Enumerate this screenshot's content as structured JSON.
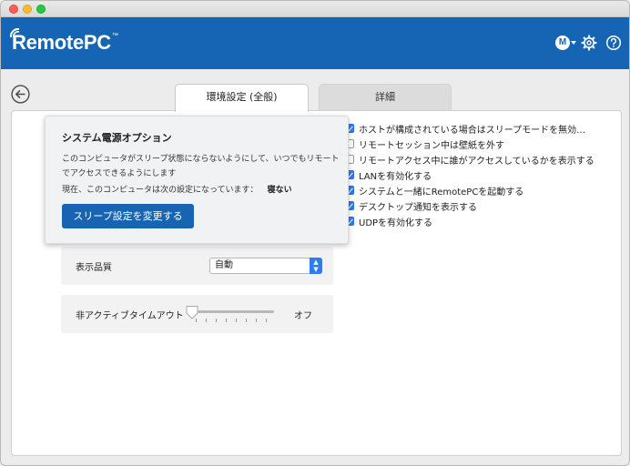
{
  "header": {
    "logo": "RemotePC",
    "logo_tm": "™",
    "avatar_initial": "M",
    "brand_color": "#1565b4"
  },
  "tabs": [
    {
      "label": "環境設定 (全般)",
      "active": true
    },
    {
      "label": "詳細",
      "active": false
    }
  ],
  "power_popover": {
    "title": "システム電源オプション",
    "description": "このコンピュータがスリープ状態にならないようにして、いつでもリモートでアクセスできるようにします",
    "status_label": "現在、このコンピュータは次の設定になっています：",
    "status_value": "寝ない",
    "button_label": "スリープ設定を変更する"
  },
  "quality": {
    "label": "表示品質",
    "selected": "自動"
  },
  "timeout": {
    "label": "非アクティブタイムアウト",
    "value_label": "オフ",
    "slider_level": 0
  },
  "options": [
    {
      "label": "ホストが構成されている場合はスリープモードを無効…",
      "checked": true
    },
    {
      "label": "リモートセッション中は壁紙を外す",
      "checked": false
    },
    {
      "label": "リモートアクセス中に誰がアクセスしているかを表示する",
      "checked": false
    },
    {
      "label": "LANを有効化する",
      "checked": true
    },
    {
      "label": "システムと一緒にRemotePCを起動する",
      "checked": true
    },
    {
      "label": "デスクトップ通知を表示する",
      "checked": true
    },
    {
      "label": "UDPを有効化する",
      "checked": true
    }
  ],
  "icons": [
    "back-arrow-icon",
    "gear-icon",
    "help-icon",
    "chevron-down-icon"
  ]
}
